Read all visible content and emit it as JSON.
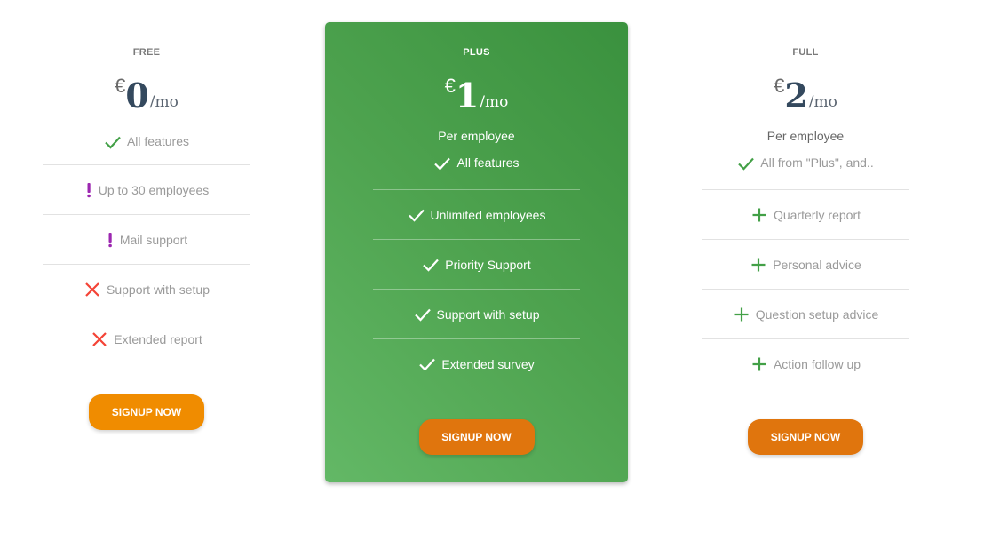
{
  "plans": [
    {
      "name": "FREE",
      "currency": "€",
      "amount": "0",
      "period": "/mo",
      "subtitle": "",
      "features": [
        {
          "icon": "check-icon",
          "label": "All features"
        },
        {
          "icon": "exclamation-icon",
          "label": "Up to 30 employees"
        },
        {
          "icon": "exclamation-icon",
          "label": "Mail support"
        },
        {
          "icon": "cross-icon",
          "label": "Support with setup"
        },
        {
          "icon": "cross-icon",
          "label": "Extended report"
        }
      ],
      "button": "SIGNUP NOW"
    },
    {
      "name": "PLUS",
      "currency": "€",
      "amount": "1",
      "period": "/mo",
      "subtitle": "Per employee",
      "features": [
        {
          "icon": "check-icon",
          "label": "All features"
        },
        {
          "icon": "check-icon",
          "label": "Unlimited employees"
        },
        {
          "icon": "check-icon",
          "label": "Priority Support"
        },
        {
          "icon": "check-icon",
          "label": "Support with setup"
        },
        {
          "icon": "check-icon",
          "label": "Extended survey"
        }
      ],
      "button": "SIGNUP NOW"
    },
    {
      "name": "FULL",
      "currency": "€",
      "amount": "2",
      "period": "/mo",
      "subtitle": "Per employee",
      "features": [
        {
          "icon": "check-icon",
          "label": "All from \"Plus\", and.."
        },
        {
          "icon": "plus-icon",
          "label": "Quarterly report"
        },
        {
          "icon": "plus-icon",
          "label": "Personal advice"
        },
        {
          "icon": "plus-icon",
          "label": "Question setup advice"
        },
        {
          "icon": "plus-icon",
          "label": "Action follow up"
        }
      ],
      "button": "SIGNUP NOW"
    }
  ],
  "colors": {
    "check": "#43a047",
    "check_on_green": "#ffffff",
    "exclamation": "#9c27b0",
    "cross": "#f44336",
    "plus": "#43a047",
    "featured_bg": "#4ea34f",
    "button_free": "#f08c00",
    "button_paid": "#e0750d"
  }
}
